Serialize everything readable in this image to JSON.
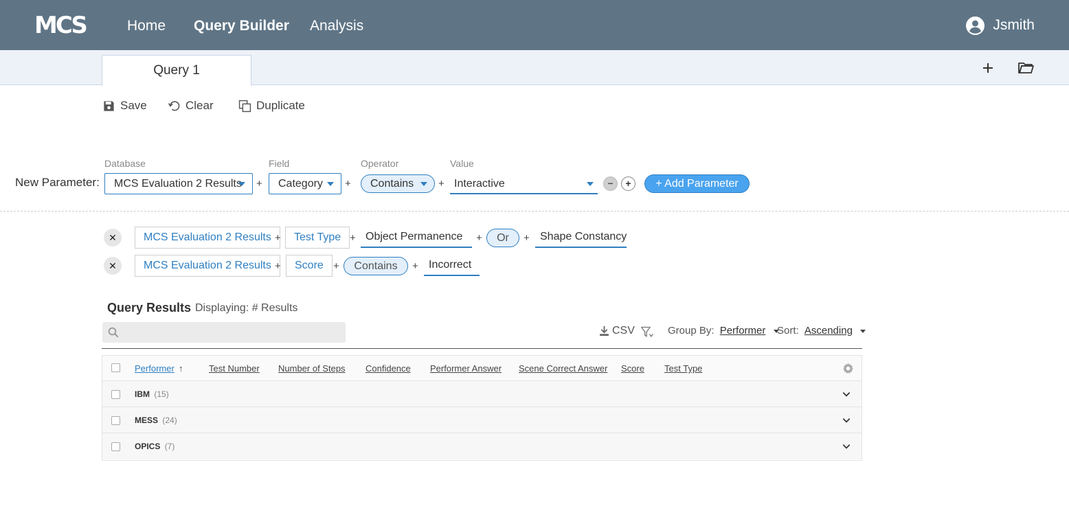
{
  "nav": {
    "logo": "MCS",
    "items": [
      "Home",
      "Query Builder",
      "Analysis"
    ],
    "user": "Jsmith"
  },
  "tabs": {
    "active": "Query 1"
  },
  "toolbar": {
    "save": "Save",
    "clear": "Clear",
    "duplicate": "Duplicate"
  },
  "new_parameter": {
    "label": "New Parameter:",
    "database_label": "Database",
    "database_value": "MCS Evaluation 2 Results",
    "field_label": "Field",
    "field_value": "Category",
    "operator_label": "Operator",
    "operator_value": "Contains",
    "value_label": "Value",
    "value_value": "Interactive",
    "add_button": "+  Add Parameter"
  },
  "query_rows": [
    {
      "database": "MCS Evaluation 2 Results",
      "field": "Test Type",
      "value1": "Object Permanence",
      "operator": "Or",
      "value2": "Shape Constancy"
    },
    {
      "database": "MCS Evaluation 2 Results",
      "field": "Score",
      "operator": "Contains",
      "value1": "Incorrect"
    }
  ],
  "results": {
    "title": "Query Results",
    "displaying": "Displaying: # Results",
    "search_placeholder": "",
    "csv": "CSV",
    "group_by_label": "Group By:",
    "group_by_value": "Performer",
    "sort_label": "Sort:",
    "sort_value": "Ascending",
    "columns": [
      "Performer",
      "Test Number",
      "Number of Steps",
      "Confidence",
      "Performer Answer",
      "Scene Correct Answer",
      "Score",
      "Test Type"
    ],
    "sort_arrow": "↑",
    "rows": [
      {
        "name": "IBM",
        "count": "(15)"
      },
      {
        "name": "MESS",
        "count": "(24)"
      },
      {
        "name": "OPICS",
        "count": "(7)"
      }
    ]
  },
  "colors": {
    "topbar": "#5f7586",
    "accent": "#2f7fc1",
    "add_button": "#4aa3ee",
    "tabstrip": "#edf2f8"
  }
}
